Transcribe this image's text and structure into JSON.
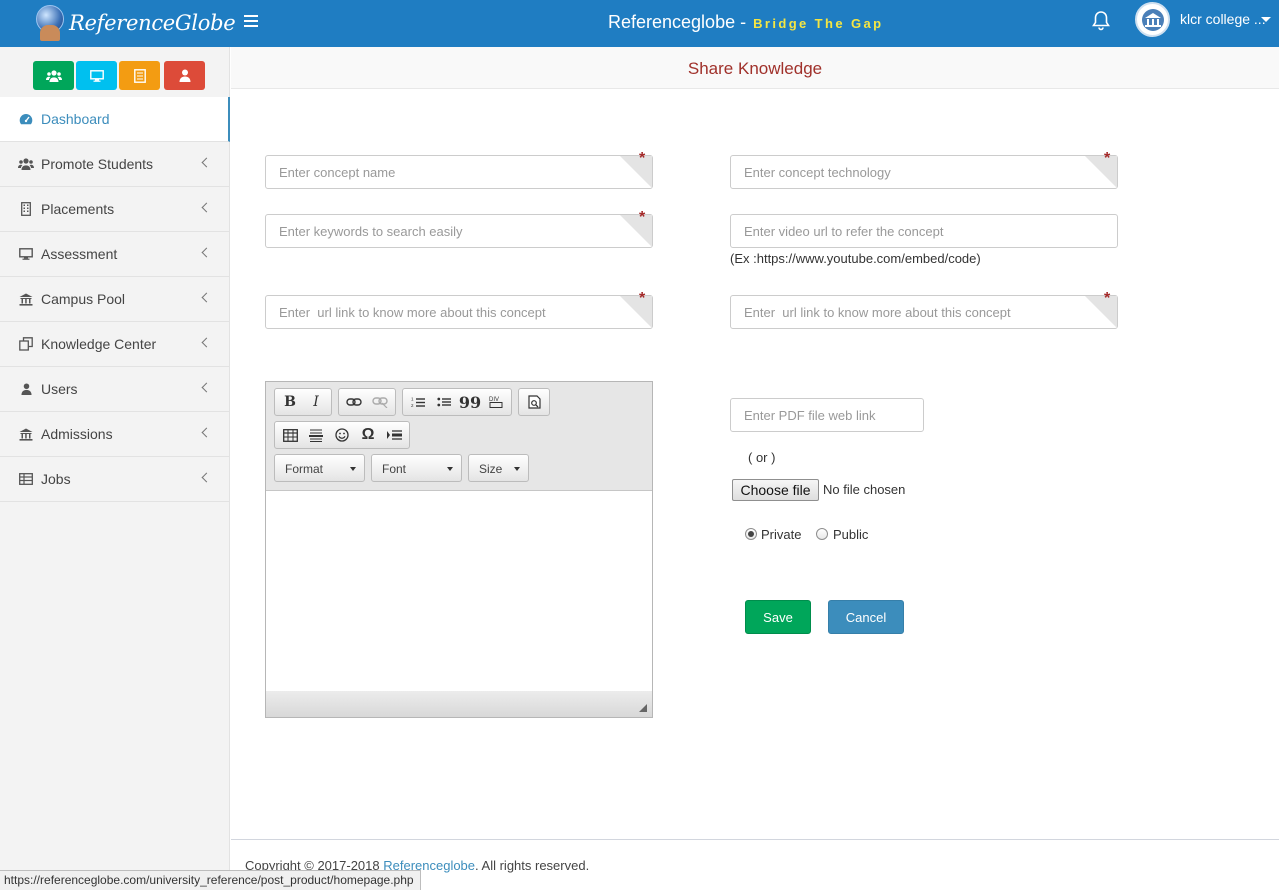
{
  "header": {
    "logo_text": "ReferenceGlobe",
    "title": "Referenceglobe - ",
    "tagline": "Bridge The Gap",
    "user_name": "klcr college ..."
  },
  "sidebar": {
    "quick_buttons": [
      {
        "icon": "users-icon",
        "color": "#00a65a"
      },
      {
        "icon": "desktop-icon",
        "color": "#00c0ef"
      },
      {
        "icon": "book-icon",
        "color": "#f39c12"
      },
      {
        "icon": "user-icon",
        "color": "#dd4b39"
      }
    ],
    "items": [
      {
        "label": "Dashboard",
        "icon": "dashboard-icon",
        "active": true
      },
      {
        "label": "Promote Students",
        "icon": "users-icon"
      },
      {
        "label": "Placements",
        "icon": "building-icon"
      },
      {
        "label": "Assessment",
        "icon": "desktop-icon"
      },
      {
        "label": "Campus Pool",
        "icon": "institution-icon"
      },
      {
        "label": "Knowledge Center",
        "icon": "clone-icon"
      },
      {
        "label": "Users",
        "icon": "user-icon"
      },
      {
        "label": "Admissions",
        "icon": "institution-icon"
      },
      {
        "label": "Jobs",
        "icon": "table-icon"
      }
    ]
  },
  "page": {
    "title": "Share Knowledge"
  },
  "form": {
    "concept_name": {
      "placeholder": "Enter concept name",
      "value": ""
    },
    "concept_technology": {
      "placeholder": "Enter concept technology",
      "value": ""
    },
    "keywords": {
      "placeholder": "Enter keywords to search easily",
      "value": ""
    },
    "video_url": {
      "placeholder": "Enter video url to refer the concept",
      "value": ""
    },
    "video_hint": "(Ex :https://www.youtube.com/embed/code)",
    "url_link_1": {
      "placeholder": "Enter  url link to know more about this concept",
      "value": ""
    },
    "url_link_2": {
      "placeholder": "Enter  url link to know more about this concept",
      "value": ""
    },
    "pdf_link": {
      "placeholder": "Enter PDF file web link",
      "value": ""
    },
    "or_text": "( or )",
    "choose_file_label": "Choose file",
    "no_file_text": "No file chosen",
    "visibility": {
      "options": [
        "Private",
        "Public"
      ],
      "selected": "Private"
    },
    "save_label": "Save",
    "cancel_label": "Cancel",
    "required_mark": "*"
  },
  "editor": {
    "format_label": "Format",
    "font_label": "Font",
    "size_label": "Size",
    "bold_glyph": "B",
    "italic_glyph": "I",
    "blockquote_glyph": "99",
    "special_char_glyph": "Ω"
  },
  "footer": {
    "prefix": "Copyright © 2017-2018 ",
    "link_text": "Referenceglobe",
    "suffix": ". All rights reserved."
  },
  "status_url": "https://referenceglobe.com/university_reference/post_product/homepage.php"
}
